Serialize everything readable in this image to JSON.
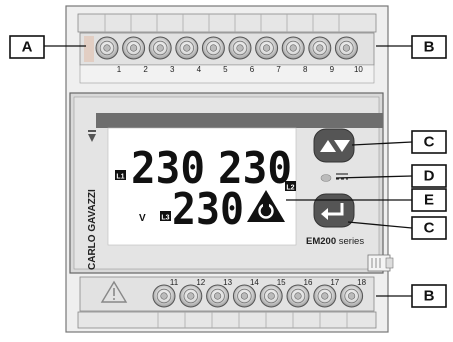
{
  "callouts": {
    "a": "A",
    "b_top": "B",
    "c_top": "C",
    "d": "D",
    "e": "E",
    "c_bottom": "C",
    "b_bottom": "B"
  },
  "terminals": {
    "top": [
      "1",
      "2",
      "3",
      "4",
      "5",
      "6",
      "7",
      "8",
      "9",
      "10"
    ],
    "bottom": [
      "11",
      "12",
      "13",
      "14",
      "15",
      "16",
      "17",
      "18"
    ]
  },
  "brand": "CARLO GAVAZZI",
  "model": {
    "name": "EM200",
    "suffix": " series"
  },
  "display": {
    "row1_left": "230",
    "row1_right": "230",
    "row2": "230",
    "unit": "V",
    "phase_l1": "L1",
    "phase_l2": "L2",
    "phase_l3": "L3"
  },
  "colors": {
    "housing": "#efefef",
    "terminal_strip": "#e2e2e2",
    "front_bezel": "#d9d9d9",
    "top_bar": "#6e6e6e",
    "lcd_background": "#ffffff",
    "button": "#555555"
  },
  "icons": [
    "warning-triangle-icon",
    "up-down-arrows-icon",
    "enter-arrow-icon",
    "phase-sequence-icon",
    "led-indicator-icon"
  ]
}
